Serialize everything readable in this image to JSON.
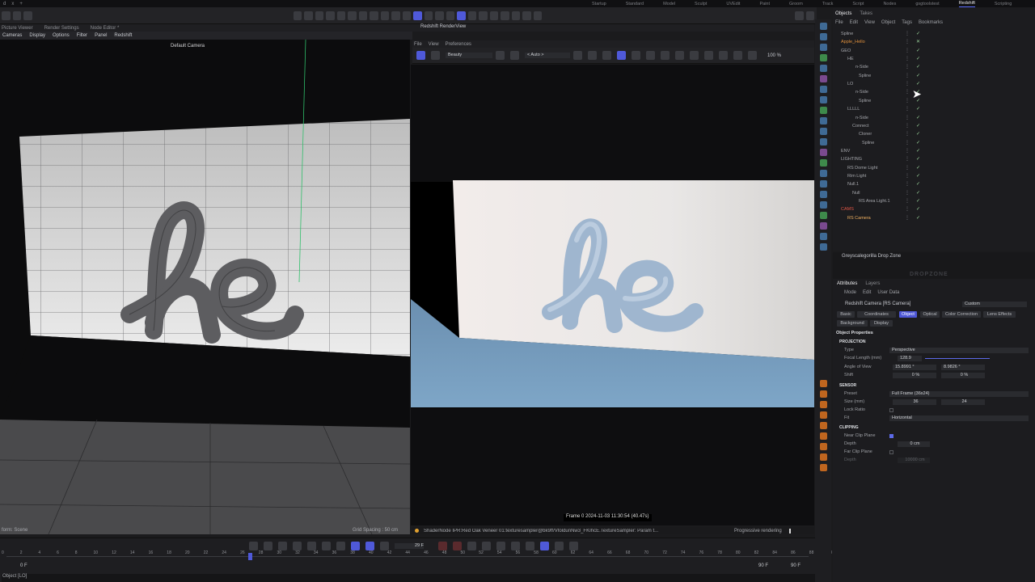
{
  "top_tabs": [
    "d",
    "x",
    "+"
  ],
  "layouts": [
    "Startup",
    "Standard",
    "Model",
    "Sculpt",
    "UVEdit",
    "Paint",
    "Groom",
    "Track",
    "Script",
    "Nodes",
    "gsgtoolstest",
    "Redshift",
    "Scripting"
  ],
  "layouts_active": "Redshift",
  "left_tabs": [
    "Picture Viewer",
    "Render Settings",
    "Node Editor *"
  ],
  "left_menu": [
    "Cameras",
    "Display",
    "Options",
    "Filter",
    "Panel",
    "Redshift"
  ],
  "viewport": {
    "camera": "Default Camera",
    "grid_spacing": "Grid Spacing : 50 cm",
    "status": "form: Scene"
  },
  "renderview": {
    "title": "Redshift RenderView",
    "menu": [
      "File",
      "View",
      "Preferences"
    ],
    "aov": "Beauty",
    "auto": "< Auto >",
    "zoom": "100 %",
    "frame_info": "Frame 0   2024-11-03 11:30:54  (40.47s)",
    "status": "ShaderNode IPR:Red Oak Veneer 01:texturesampler@bk9ff/VfoldunNw3_FKIhcE.TextureSampler: Param t...",
    "progress": "Progressive rendering"
  },
  "timeline": {
    "current_frame": "29 F",
    "start": "0 F",
    "end_a": "90 F",
    "end_b": "90 F",
    "ticks": [
      "0",
      "2",
      "4",
      "6",
      "8",
      "10",
      "12",
      "14",
      "16",
      "18",
      "20",
      "22",
      "24",
      "26",
      "28",
      "30",
      "32",
      "34",
      "36",
      "38",
      "40",
      "42",
      "44",
      "46",
      "48",
      "50",
      "52",
      "54",
      "56",
      "58",
      "60",
      "62",
      "64",
      "66",
      "68",
      "70",
      "72",
      "74",
      "76",
      "78",
      "80",
      "82",
      "84",
      "86",
      "88",
      "90"
    ],
    "status_left": "Object [LO]"
  },
  "objects": {
    "tabs": [
      "Objects",
      "Takes"
    ],
    "menu": [
      "File",
      "Edit",
      "View",
      "Object",
      "Tags",
      "Bookmarks"
    ],
    "items": [
      {
        "label": "Spline",
        "style": ""
      },
      {
        "label": "Apple_Hello",
        "style": "orange"
      },
      {
        "label": "GEO",
        "style": ""
      },
      {
        "label": "HE",
        "style": ""
      },
      {
        "label": "n-Side",
        "style": ""
      },
      {
        "label": "Spline",
        "style": ""
      },
      {
        "label": "LO",
        "style": ""
      },
      {
        "label": "n-Side",
        "style": ""
      },
      {
        "label": "Spline",
        "style": ""
      },
      {
        "label": "LLLLL",
        "style": ""
      },
      {
        "label": "n-Side",
        "style": ""
      },
      {
        "label": "Connect",
        "style": ""
      },
      {
        "label": "Cloner",
        "style": ""
      },
      {
        "label": "Spline",
        "style": ""
      },
      {
        "label": "ENV",
        "style": ""
      },
      {
        "label": "LIGHTING",
        "style": ""
      },
      {
        "label": "RS Dome Light",
        "style": ""
      },
      {
        "label": "Rim Light",
        "style": ""
      },
      {
        "label": "Null.1",
        "style": ""
      },
      {
        "label": "Null",
        "style": ""
      },
      {
        "label": "RS Area Light.1",
        "style": ""
      },
      {
        "label": "CAMS",
        "style": "red"
      },
      {
        "label": "RS Camera",
        "style": "sel"
      }
    ]
  },
  "dropzone": {
    "title": "Greyscalegorilla Drop Zone",
    "logo": "DROPZONE"
  },
  "attributes": {
    "tabs": [
      "Attributes",
      "Layers"
    ],
    "menu": [
      "Mode",
      "Edit",
      "User Data"
    ],
    "object_name": "Redshift Camera [RS Camera]",
    "preset_mode": "Custom",
    "subtabs_row1": [
      "Basic",
      "Coordinates",
      "Object",
      "Optical",
      "Color Correction",
      "Lens Effects"
    ],
    "subtabs_row2": [
      "Background",
      "Display"
    ],
    "active_subtab": "Object",
    "section_title": "Object Properties",
    "projection_head": "PROJECTION",
    "type_label": "Type",
    "type_value": "Perspective",
    "focal_label": "Focal Length (mm)",
    "focal_value": "128.9",
    "aov_label": "Angle of View",
    "aov_a": "15.8991 °",
    "aov_b": "8.9826 °",
    "shift_label": "Shift",
    "shift_a": "0 %",
    "shift_b": "0 %",
    "sensor_head": "SENSOR",
    "preset_label": "Preset",
    "preset_value": "Full Frame (36x24)",
    "size_label": "Size (mm)",
    "size_a": "36",
    "size_b": "24",
    "lock_label": "Lock Ratio",
    "fit_label": "Fit",
    "fit_value": "Horizontal",
    "clipping_head": "CLIPPING",
    "near_label": "Near Clip Plane",
    "depth_label": "Depth",
    "depth_value": "0 cm",
    "far_label": "Far Clip Plane",
    "far_depth_label": "Depth",
    "far_depth_value": "10000 cm"
  },
  "colors": {
    "accent": "#4f59d9",
    "selected": "#f0b060",
    "bg": "#1b1b1d"
  }
}
